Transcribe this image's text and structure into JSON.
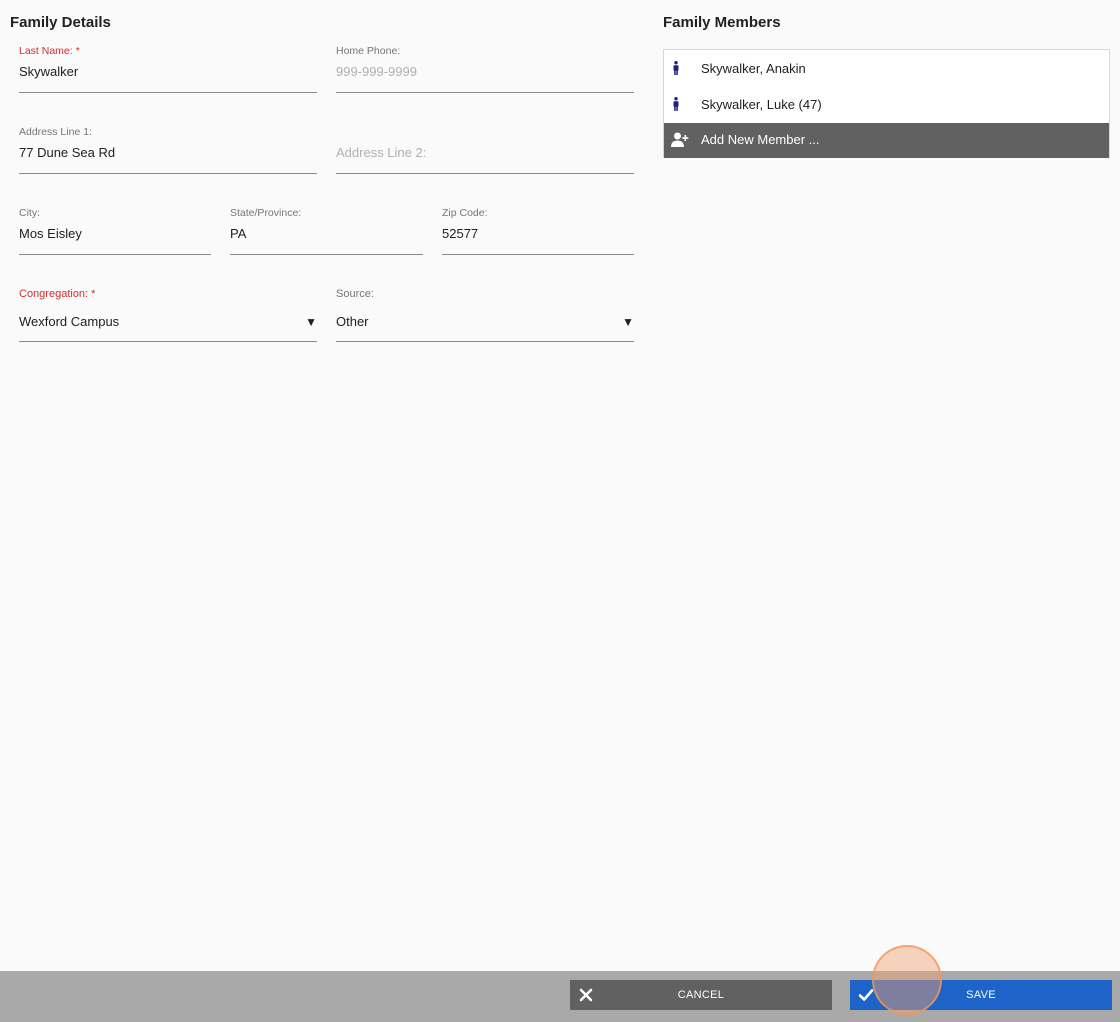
{
  "family_details": {
    "title": "Family Details",
    "last_name": {
      "label": "Last Name: *",
      "value": "Skywalker"
    },
    "home_phone": {
      "label": "Home Phone:",
      "placeholder": "999-999-9999"
    },
    "address1": {
      "label": "Address Line 1:",
      "value": "77 Dune Sea Rd"
    },
    "address2": {
      "placeholder": "Address Line 2:"
    },
    "city": {
      "label": "City:",
      "value": "Mos Eisley"
    },
    "state": {
      "label": "State/Province:",
      "value": "PA"
    },
    "zip": {
      "label": "Zip Code:",
      "value": "52577"
    },
    "congregation": {
      "label": "Congregation: *",
      "value": "Wexford Campus",
      "caret": "▼"
    },
    "source": {
      "label": "Source:",
      "value": "Other",
      "caret": "▼"
    }
  },
  "family_members": {
    "title": "Family Members",
    "members": [
      {
        "name": "Skywalker, Anakin",
        "icon": "person-icon"
      },
      {
        "name": "Skywalker, Luke (47)",
        "icon": "person-icon"
      }
    ],
    "add_label": "Add New Member ...",
    "add_icon": "add-user-icon"
  },
  "footer": {
    "cancel_label": "CANCEL",
    "cancel_icon": "close-icon",
    "save_label": "SAVE",
    "save_icon": "check-icon"
  },
  "colors": {
    "required": "#d32f2f",
    "member_icon": "#1a237e",
    "add_row_bg": "#616161",
    "cancel_bg": "#616161",
    "save_bg": "#1e63c8",
    "footer_bg": "#a9a9a9"
  }
}
